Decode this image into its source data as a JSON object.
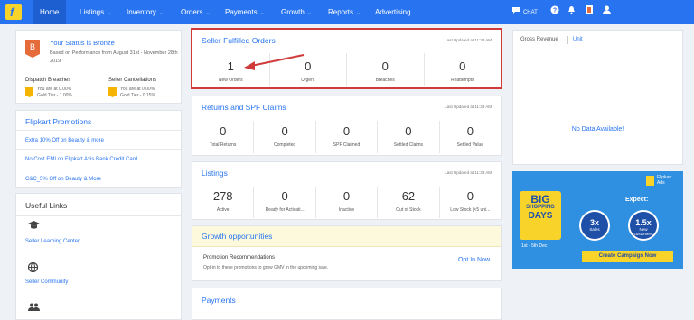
{
  "nav": {
    "home": "Home",
    "items": [
      "Listings",
      "Inventory",
      "Orders",
      "Payments",
      "Growth",
      "Reports"
    ],
    "advertising": "Advertising",
    "chat": "CHAT",
    "icons": [
      "chat-icon",
      "help-icon",
      "bell-icon",
      "flag-icon",
      "user-icon"
    ]
  },
  "status": {
    "badge": "B",
    "title": "Your Status is Bronze",
    "text": "Based on Performance from August 31st - November 28th 2019",
    "dispatch_title": "Dispatch Breaches",
    "dispatch_text1": "You are at 0.00%",
    "dispatch_text2": "Gold Tier - 1.00%",
    "cancel_title": "Seller Cancellations",
    "cancel_text1": "You are at 0.00%",
    "cancel_text2": "Gold Tier - 0.15%"
  },
  "promotions": {
    "title": "Flipkart Promotions",
    "items": [
      "Extra 10% Off on Beauty & more",
      "No Cost EMI on Flipkart Axis Bank Credit Card",
      "C&C_5% Off on Beauty & More"
    ]
  },
  "useful_links": {
    "title": "Useful Links",
    "items": [
      "Seller Learning Center",
      "Seller Community"
    ]
  },
  "sfo": {
    "title": "Seller Fulfilled Orders",
    "updated": "Last Updated at 11:33 AM",
    "stats": [
      {
        "value": "1",
        "label": "New Orders"
      },
      {
        "value": "0",
        "label": "Urgent"
      },
      {
        "value": "0",
        "label": "Breaches"
      },
      {
        "value": "0",
        "label": "Reattempts"
      }
    ]
  },
  "returns": {
    "title": "Returns and SPF Claims",
    "updated": "Last Updated at 11:33 AM",
    "stats": [
      {
        "value": "0",
        "label": "Total Returns"
      },
      {
        "value": "0",
        "label": "Completed"
      },
      {
        "value": "0",
        "label": "SPF Claimed"
      },
      {
        "value": "0",
        "label": "Settled Claims"
      },
      {
        "value": "0",
        "label": "Settled Value"
      }
    ]
  },
  "listings": {
    "title": "Listings",
    "updated": "Last Updated at 11:33 AM",
    "stats": [
      {
        "value": "278",
        "label": "Active"
      },
      {
        "value": "0",
        "label": "Ready for Activati..."
      },
      {
        "value": "0",
        "label": "Inactive"
      },
      {
        "value": "62",
        "label": "Out of Stock"
      },
      {
        "value": "0",
        "label": "Low Stock (<5 uni..."
      }
    ]
  },
  "growth": {
    "title": "Growth opportunities",
    "rec_title": "Promotion Recommendations",
    "rec_desc": "Opt-in to these promotions to grow GMV in the upcoming sale.",
    "opt_in": "Opt In Now"
  },
  "payments": {
    "title": "Payments"
  },
  "gross": {
    "title": "Gross Revenue",
    "unit": "Unit",
    "nodata": "No Data Available!"
  },
  "ad": {
    "big": "BIG",
    "shopping": "SHOPPING",
    "days": "DAYS",
    "date": "1st - 5th Dec",
    "brand1": "Flipkart",
    "brand2": "Ads",
    "expect": "Expect:",
    "c1_big": "3x",
    "c1_small": "Sales",
    "c2_big": "1.5x",
    "c2_small": "New customers",
    "cta": "Create Campaign Now"
  },
  "colors": {
    "nav": "#2874f0",
    "highlight": "#d13a3a",
    "accent_yellow": "#f8d32a"
  }
}
